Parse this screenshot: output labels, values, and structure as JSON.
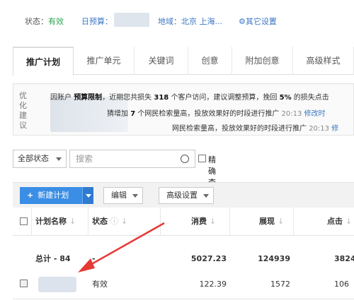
{
  "status_bar": {
    "status_label": "状态：",
    "status_value": "有效",
    "budget_label": "日预算：",
    "region_label": "地域：北京 上海...",
    "other_settings": "其它设置"
  },
  "tabs": [
    {
      "label": "推广计划",
      "active": true
    },
    {
      "label": "推广单元"
    },
    {
      "label": "关键词"
    },
    {
      "label": "创意"
    },
    {
      "label": "附加创意"
    },
    {
      "label": "高级样式"
    }
  ],
  "advice": {
    "title": "优化建议",
    "line1_a": "因账户",
    "line1_b": "预算限制",
    "line1_c": "，近期您共损失",
    "line1_d": "318",
    "line1_e": "个客户访问，建议调整预算，挽回",
    "line1_f": "5%",
    "line1_g": "的损失点击",
    "line2_a": "猜增加",
    "line2_b": "7",
    "line2_c": "个网民检索量高，投放效果好的时段进行推广",
    "line2_time": "20:13",
    "line2_link": "修改时",
    "line3_a": "网民检索量高，投放效果好的时段进行推广",
    "line3_time": "20:13",
    "line3_link": "修"
  },
  "filter": {
    "status_select": "全部状态",
    "search_placeholder": "搜索",
    "exact_label": "精确查询"
  },
  "toolbar": {
    "new_plan": "新建计划",
    "edit": "编辑",
    "advanced_settings": "高级设置"
  },
  "table": {
    "headers": {
      "name": "计划名称",
      "status": "状态",
      "cost": "消费",
      "impressions": "展现",
      "clicks": "点击"
    },
    "total_row": {
      "name": "总计 - 84",
      "status": "-",
      "cost": "5027.23",
      "impressions": "124939",
      "clicks": "3824"
    },
    "rows": [
      {
        "status": "有效",
        "cost": "122.39",
        "impressions": "1572",
        "clicks": "106"
      }
    ]
  },
  "colors": {
    "accent_blue": "#3a8ee6",
    "link_blue": "#3a76c4",
    "status_green": "#2ea44f",
    "arrow_red": "#e53935"
  },
  "icons": {
    "gear": "gear-icon",
    "search": "search-icon",
    "help": "help-circle-icon",
    "sort": "sort-arrow-icon",
    "plus": "plus-icon",
    "caret": "caret-down-icon",
    "annotation_arrow": "red-arrow-icon"
  }
}
